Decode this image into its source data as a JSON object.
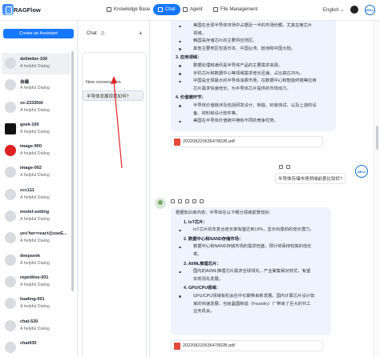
{
  "header": {
    "brand": "RAGFlow",
    "nav": [
      {
        "label": "Knowledge Base",
        "icon": "knowledge-base-icon",
        "active": false
      },
      {
        "label": "Chat",
        "icon": "chat-icon",
        "active": true
      },
      {
        "label": "Agent",
        "icon": "agent-icon",
        "active": false
      },
      {
        "label": "File Management",
        "icon": "file-icon",
        "active": false
      }
    ],
    "language": "English",
    "avatar_text": "DELL"
  },
  "assistants": {
    "create_label": "Create an Assistant",
    "items": [
      {
        "name": "delimiter-100",
        "desc": "A helpful Dialog",
        "selected": true
      },
      {
        "name": "自编",
        "desc": "A helpful Dialog"
      },
      {
        "name": "xx-23335ttt",
        "desc": "A helpful Dialog"
      },
      {
        "name": "geek-100",
        "desc": "A helpful Dialog",
        "thumb": "dark"
      },
      {
        "name": "image-900",
        "desc": "A helpful Dialog",
        "thumb": "red"
      },
      {
        "name": "image-002",
        "desc": "A helpful Dialog"
      },
      {
        "name": "ccc111",
        "desc": "A helpful Dialog"
      },
      {
        "name": "model-setting",
        "desc": "A helpful Dialog"
      },
      {
        "name": "yes'her>react@useE...",
        "desc": "A helpful Dialog"
      },
      {
        "name": "deepseek",
        "desc": "A helpful Dialog"
      },
      {
        "name": "repetitive-001",
        "desc": "A helpful Dialog"
      },
      {
        "name": "loading-001",
        "desc": "A helpful Dialog"
      },
      {
        "name": "chat-520",
        "desc": "A helpful Dialog"
      },
      {
        "name": "chat430",
        "desc": ""
      }
    ]
  },
  "chats": {
    "title": "Chat",
    "count": "2",
    "add_icon": "plus-icon",
    "items": [
      {
        "label": "New conversation"
      },
      {
        "label": "半导体发展现状如何?",
        "selected": true
      }
    ]
  },
  "messages": {
    "first_bubble": {
      "lines_top": [
        "美国在全球半导体市场中占据近一半的市场份额，尤其在微芯片",
        "领域。",
        "韩国是存储芯片的主要供应地区。",
        "其他主要地区包括日本、中国台湾、欧洲和中国大陆。"
      ],
      "section3_title": "3. 应用领域：",
      "section3_items": [
        "数据处理和通讯是半导体产品的主要需求来源。",
        "手机芯片和数据中心等领域需求增长迅速，占比高达25%。",
        "中国是全球最大的半导体消费市场，在数据中心和智能终端等应用",
        "芯片需求快速增长，为半导体芯片提供的市场动力。"
      ],
      "section4_title": "4. 价值链环节：",
      "section4_items": [
        "半导体价值链涉及包括研发设计、制造、封装测试、以及上游的设",
        "备、材料和设计软件等。",
        "美国在半导体价值链中拥有不同的竞争优势。"
      ],
      "file": "20220822053647802B.pdf"
    },
    "user_message": "半导体存储市场领域前景比较好?",
    "second_bubble": {
      "intro": "根据知识库内容，半导体在以下细分领域前景较好：",
      "s1_title": "1. IoT芯片：",
      "s1_items": [
        "IoT芯片的年复合增长率有望达到13%，显示出强劲的增长潜力。"
      ],
      "s2_title": "2. 数据中心和NAND存储市场：",
      "s2_items": [
        "数据中心和NAND存储市场的需求旺盛，预计将保持较高的增长",
        "率。"
      ],
      "s3_title": "3. AI/ML推理芯片：",
      "s3_items": [
        "国内的AI/ML推理芯片需求全球领先，产业聚集相对较优，有望",
        "实现领先发展。"
      ],
      "s4_title": "4. GPU/CPU领域：",
      "s4_items": [
        "GPU/CPU领域有机会在中长期带来新发展。国内计算芯片设计如",
        "家的快速发展，也给晶圆制造（Foundry）厂带来了巨大的代工",
        "业务机会。"
      ],
      "file": "20220822053647802B.pdf"
    }
  }
}
